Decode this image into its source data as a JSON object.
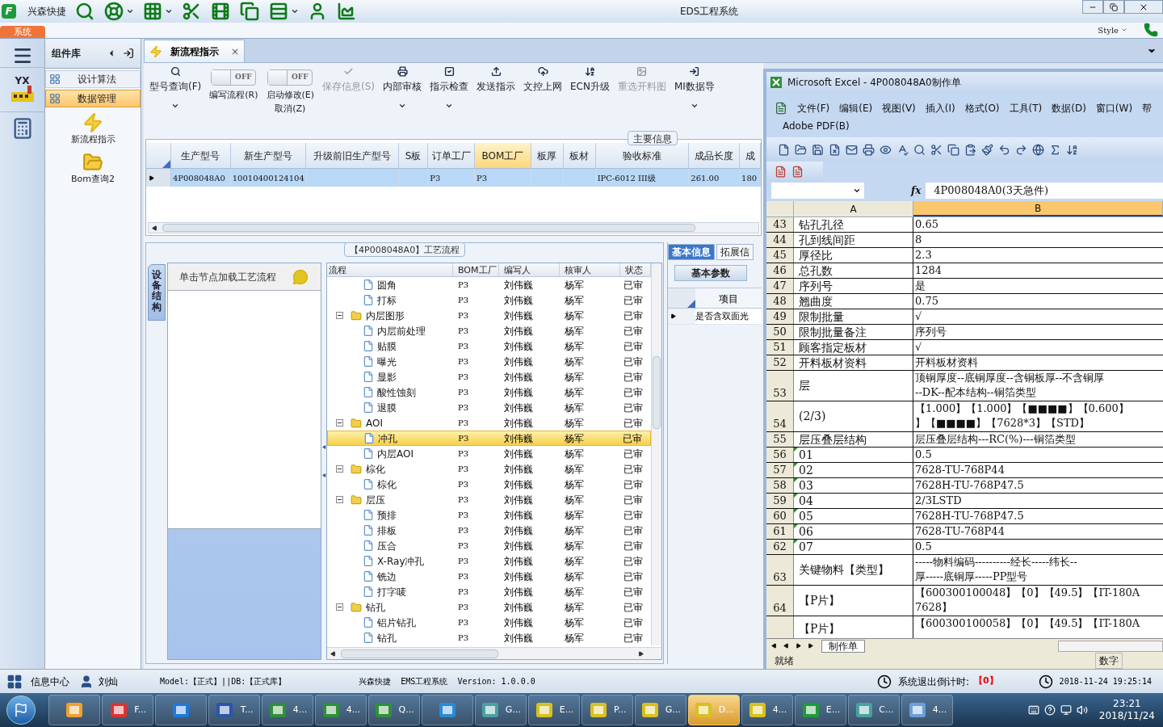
{
  "title_bar": {
    "logo": "F",
    "app_name": "兴森快捷",
    "title": "EDS工程系统"
  },
  "ribbon": {
    "tab": "系统",
    "style_label": "Style"
  },
  "nav_rail": {
    "logo_text": "YX"
  },
  "component_library": {
    "title": "组件库",
    "items": [
      {
        "label": "设计算法",
        "selected": false
      },
      {
        "label": "数据管理",
        "selected": true
      }
    ],
    "tools": [
      "新流程指示",
      "Bom查询2"
    ]
  },
  "document_tab": {
    "label": "新流程指示",
    "close": "×"
  },
  "toolbar": [
    {
      "kind": "button",
      "label": "型号查询(F)",
      "dropdown": true,
      "disabled": false
    },
    {
      "kind": "toggle",
      "label": "编写流程(R)",
      "on": false,
      "state_text": "OFF"
    },
    {
      "kind": "toggle",
      "label": "启动修改(E)",
      "label_2": "取消(Z)",
      "on": false,
      "state_text": "OFF"
    },
    {
      "kind": "button",
      "label": "保存信息(S)",
      "dropdown": false,
      "disabled": true
    },
    {
      "kind": "button",
      "label": "内部审核",
      "dropdown": true,
      "disabled": false
    },
    {
      "kind": "button",
      "label": "指示检查",
      "dropdown": true,
      "disabled": false
    },
    {
      "kind": "button",
      "label": "发送指示",
      "dropdown": false,
      "disabled": false
    },
    {
      "kind": "button",
      "label": "文控上网",
      "dropdown": false,
      "disabled": false
    },
    {
      "kind": "button",
      "label": "ECN升级",
      "dropdown": false,
      "disabled": false
    },
    {
      "kind": "button",
      "label": "重选开料图",
      "dropdown": false,
      "disabled": true
    },
    {
      "kind": "button",
      "label": "MI数据导",
      "dropdown": true,
      "disabled": false
    }
  ],
  "main_info": {
    "title": "主要信息",
    "columns": [
      {
        "label": "生产型号",
        "selected": false
      },
      {
        "label": "新生产型号",
        "selected": false
      },
      {
        "label": "升级前旧生产型号",
        "selected": false
      },
      {
        "label": "S板",
        "selected": false
      },
      {
        "label": "订单工厂",
        "selected": false
      },
      {
        "label": "BOM工厂",
        "selected": true
      },
      {
        "label": "板厚",
        "selected": false
      },
      {
        "label": "板材",
        "selected": false
      },
      {
        "label": "验收标准",
        "selected": false
      },
      {
        "label": "成品长度",
        "selected": false
      },
      {
        "label": "成",
        "selected": false
      }
    ],
    "rows": [
      {
        "selected": true,
        "cells": [
          "4P008048A0",
          "10010400124104",
          "",
          "",
          "P3",
          "P3",
          "",
          "",
          "IPC-6012 III级",
          "261.00",
          "180"
        ]
      }
    ]
  },
  "process": {
    "title": "【4P008048A0】工艺流程",
    "side_tab": "设备结构",
    "hint": "单击节点加载工艺流程",
    "columns": [
      "流程",
      "BOM工厂",
      "编写人",
      "核审人",
      "状态"
    ],
    "tree": [
      {
        "children": [
          {
            "label": "圆角",
            "bom": "P3",
            "writer": "刘伟巍",
            "reviewer": "杨军",
            "status": "已审",
            "selected": false
          },
          {
            "label": "打标",
            "bom": "P3",
            "writer": "刘伟巍",
            "reviewer": "杨军",
            "status": "已审",
            "selected": false
          }
        ]
      },
      {
        "label": "内层图形",
        "bom": "P3",
        "writer": "刘伟巍",
        "reviewer": "杨军",
        "status": "已审",
        "selected": false,
        "expanded": true,
        "children": [
          {
            "label": "内层前处理",
            "bom": "P3",
            "writer": "刘伟巍",
            "reviewer": "杨军",
            "status": "已审",
            "selected": false
          },
          {
            "label": "贴膜",
            "bom": "P3",
            "writer": "刘伟巍",
            "reviewer": "杨军",
            "status": "已审",
            "selected": false
          },
          {
            "label": "曝光",
            "bom": "P3",
            "writer": "刘伟巍",
            "reviewer": "杨军",
            "status": "已审",
            "selected": false
          },
          {
            "label": "显影",
            "bom": "P3",
            "writer": "刘伟巍",
            "reviewer": "杨军",
            "status": "已审",
            "selected": false
          },
          {
            "label": "酸性蚀刻",
            "bom": "P3",
            "writer": "刘伟巍",
            "reviewer": "杨军",
            "status": "已审",
            "selected": false
          },
          {
            "label": "退膜",
            "bom": "P3",
            "writer": "刘伟巍",
            "reviewer": "杨军",
            "status": "已审",
            "selected": false
          }
        ]
      },
      {
        "label": "AOI",
        "bom": "P3",
        "writer": "刘伟巍",
        "reviewer": "杨军",
        "status": "已审",
        "selected": false,
        "expanded": true,
        "children": [
          {
            "label": "冲孔",
            "bom": "P3",
            "writer": "刘伟巍",
            "reviewer": "杨军",
            "status": "已审",
            "selected": true
          },
          {
            "label": "内层AOI",
            "bom": "P3",
            "writer": "刘伟巍",
            "reviewer": "杨军",
            "status": "已审",
            "selected": false
          }
        ]
      },
      {
        "label": "棕化",
        "bom": "P3",
        "writer": "刘伟巍",
        "reviewer": "杨军",
        "status": "已审",
        "selected": false,
        "expanded": true,
        "children": [
          {
            "label": "棕化",
            "bom": "P3",
            "writer": "刘伟巍",
            "reviewer": "杨军",
            "status": "已审",
            "selected": false
          }
        ]
      },
      {
        "label": "层压",
        "bom": "P3",
        "writer": "刘伟巍",
        "reviewer": "杨军",
        "status": "已审",
        "selected": false,
        "expanded": true,
        "children": [
          {
            "label": "预排",
            "bom": "P3",
            "writer": "刘伟巍",
            "reviewer": "杨军",
            "status": "已审",
            "selected": false
          },
          {
            "label": "排板",
            "bom": "P3",
            "writer": "刘伟巍",
            "reviewer": "杨军",
            "status": "已审",
            "selected": false
          },
          {
            "label": "压合",
            "bom": "P3",
            "writer": "刘伟巍",
            "reviewer": "杨军",
            "status": "已审",
            "selected": false
          },
          {
            "label": "X-Ray冲孔",
            "bom": "P3",
            "writer": "刘伟巍",
            "reviewer": "杨军",
            "status": "已审",
            "selected": false
          },
          {
            "label": "铣边",
            "bom": "P3",
            "writer": "刘伟巍",
            "reviewer": "杨军",
            "status": "已审",
            "selected": false
          },
          {
            "label": "打字唛",
            "bom": "P3",
            "writer": "刘伟巍",
            "reviewer": "杨军",
            "status": "已审",
            "selected": false
          }
        ]
      },
      {
        "label": "钻孔",
        "bom": "P3",
        "writer": "刘伟巍",
        "reviewer": "杨军",
        "status": "已审",
        "selected": false,
        "expanded": true,
        "children": [
          {
            "label": "铝片钻孔",
            "bom": "P3",
            "writer": "刘伟巍",
            "reviewer": "杨军",
            "status": "已审",
            "selected": false
          },
          {
            "label": "钻孔",
            "bom": "P3",
            "writer": "刘伟巍",
            "reviewer": "杨军",
            "status": "已审",
            "selected": false
          }
        ]
      }
    ]
  },
  "side_panel": {
    "tabs": [
      {
        "label": "基本信息",
        "selected": true
      },
      {
        "label": "拓展信",
        "selected": false
      }
    ],
    "sub_tab": "基本参数",
    "column": "项目",
    "rows": [
      "是否含双面光"
    ]
  },
  "excel": {
    "title": "Microsoft Excel - 4P008048A0制作单",
    "menu": [
      "文件(F)",
      "编辑(E)",
      "视图(V)",
      "插入(I)",
      "格式(O)",
      "工具(T)",
      "数据(D)",
      "窗口(W)",
      "帮"
    ],
    "menu_2": "Adobe PDF(B)",
    "fx": "fx",
    "formula": "4P008048A0(3天急件)",
    "columns": [
      {
        "label": "A",
        "selected": false
      },
      {
        "label": "B",
        "selected": true
      }
    ],
    "rows": [
      {
        "num": "43",
        "a": "钻孔孔径",
        "b": [
          "0.65"
        ],
        "flag": false
      },
      {
        "num": "44",
        "a": "孔到线间距",
        "b": [
          "8"
        ],
        "flag": false
      },
      {
        "num": "45",
        "a": "厚径比",
        "b": [
          "2.3"
        ],
        "flag": false
      },
      {
        "num": "46",
        "a": "总孔数",
        "b": [
          "1284"
        ],
        "flag": false
      },
      {
        "num": "47",
        "a": "序列号",
        "b": [
          "是"
        ],
        "flag": false
      },
      {
        "num": "48",
        "a": "翘曲度",
        "b": [
          "0.75"
        ],
        "flag": false
      },
      {
        "num": "49",
        "a": "限制批量",
        "b": [
          "√"
        ],
        "flag": false
      },
      {
        "num": "50",
        "a": "限制批量备注",
        "b": [
          "序列号"
        ],
        "flag": false
      },
      {
        "num": "51",
        "a": "顾客指定板材",
        "b": [
          "√"
        ],
        "flag": false
      },
      {
        "num": "52",
        "a": "开料板材资料",
        "b": [
          "开料板材资料"
        ],
        "flag": false
      },
      {
        "num": "53",
        "a": "层",
        "b": [
          "顶铜厚度--底铜厚度--含铜板厚--不含铜厚",
          "--DK--配本结构--铜箔类型"
        ],
        "flag": false
      },
      {
        "num": "54",
        "a": "(2/3)",
        "b": [
          "【1.000】【1.000】【■■■■】【0.600】",
          "】【■■■■】【7628*3】【STD】"
        ],
        "flag": false
      },
      {
        "num": "55",
        "a": "层压叠层结构",
        "b": [
          "层压叠层结构---RC(%)---铜箔类型"
        ],
        "flag": false
      },
      {
        "num": "56",
        "a": "01",
        "b": [
          "0.5"
        ],
        "flag": true
      },
      {
        "num": "57",
        "a": "02",
        "b": [
          "7628-TU-768P44"
        ],
        "flag": true
      },
      {
        "num": "58",
        "a": "03",
        "b": [
          "7628H-TU-768P47.5"
        ],
        "flag": true
      },
      {
        "num": "59",
        "a": "04",
        "b": [
          "2/3LSTD"
        ],
        "flag": true
      },
      {
        "num": "60",
        "a": "05",
        "b": [
          "7628H-TU-768P47.5"
        ],
        "flag": true
      },
      {
        "num": "61",
        "a": "06",
        "b": [
          "7628-TU-768P44"
        ],
        "flag": true
      },
      {
        "num": "62",
        "a": "07",
        "b": [
          "0.5"
        ],
        "flag": true
      },
      {
        "num": "63",
        "a": "关键物料【类型】",
        "b": [
          "-----物料编码----------经长-----纬长--",
          "厚-----底铜厚-----PP型号"
        ],
        "flag": false
      },
      {
        "num": "64",
        "a": "【P片】",
        "b": [
          "【600300100048】【0】【49.5】【IT-180A",
          "7628】"
        ],
        "flag": false
      },
      {
        "a": "【P片】",
        "b": [
          "【600300100058】【0】【49.5】【IT-180A"
        ],
        "flag": false
      }
    ],
    "sheet_tab": "制作单",
    "status": "就绪",
    "status_2": "数字"
  },
  "status_bar": {
    "info_center": "信息中心",
    "user": "刘灿",
    "model": "Model:【正式】||DB:【正式库】",
    "product": "兴森快捷  EMS工程系统  Version: 1.0.0.0",
    "countdown_label": "系统退出倒计时:",
    "countdown": "【0】",
    "datetime": "2018-11-24 19:25:14"
  },
  "taskbar": {
    "items": [
      {
        "selected": false
      },
      {
        "label": "F...",
        "selected": false
      },
      {
        "selected": false
      },
      {
        "label": "T...",
        "selected": false
      },
      {
        "label": "4...",
        "selected": false
      },
      {
        "label": "4...",
        "selected": false
      },
      {
        "label": "Q...",
        "selected": false
      },
      {
        "selected": false
      },
      {
        "label": "G...",
        "selected": false
      },
      {
        "label": "E...",
        "selected": false
      },
      {
        "label": "P...",
        "selected": false
      },
      {
        "label": "G...",
        "selected": false
      },
      {
        "label": "D...",
        "selected": true
      },
      {
        "label": "4...",
        "selected": false
      },
      {
        "label": "E...",
        "selected": false
      },
      {
        "label": "C...",
        "selected": false
      },
      {
        "label": "4...",
        "selected": false
      }
    ],
    "time": "23:21",
    "date": "2018/11/24"
  }
}
